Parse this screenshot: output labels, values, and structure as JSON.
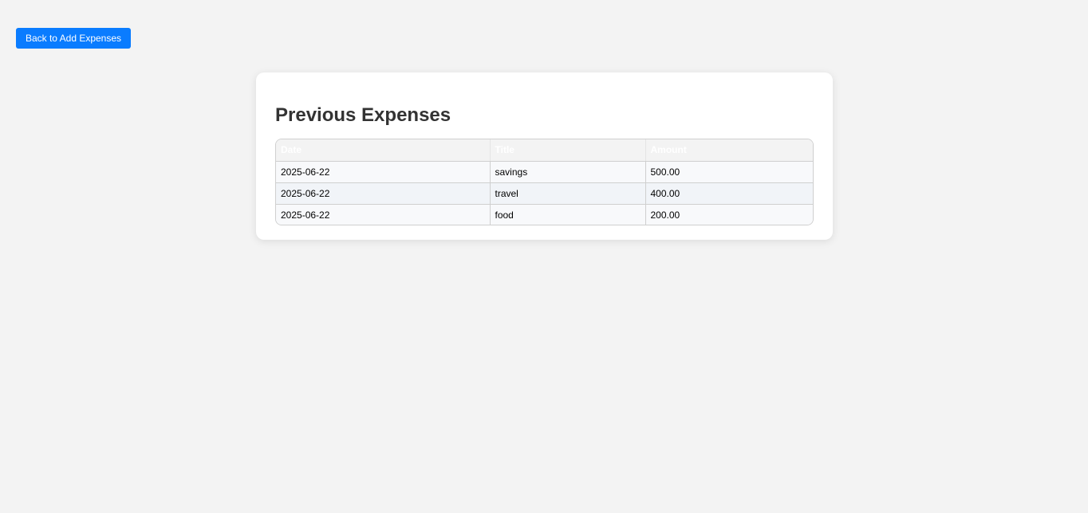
{
  "header": {
    "back_label": "Back to Add Expenses"
  },
  "main": {
    "title": "Previous Expenses",
    "table": {
      "columns": [
        "Date",
        "Title",
        "Amount"
      ],
      "rows": [
        [
          "2025-06-22",
          "savings",
          "500.00"
        ],
        [
          "2025-06-22",
          "travel",
          "400.00"
        ],
        [
          "2025-06-22",
          "food",
          "200.00"
        ]
      ]
    }
  },
  "colors": {
    "page_background": "#f3f3f3",
    "button_accent": "#0a7cff",
    "title_text": "#333333"
  }
}
